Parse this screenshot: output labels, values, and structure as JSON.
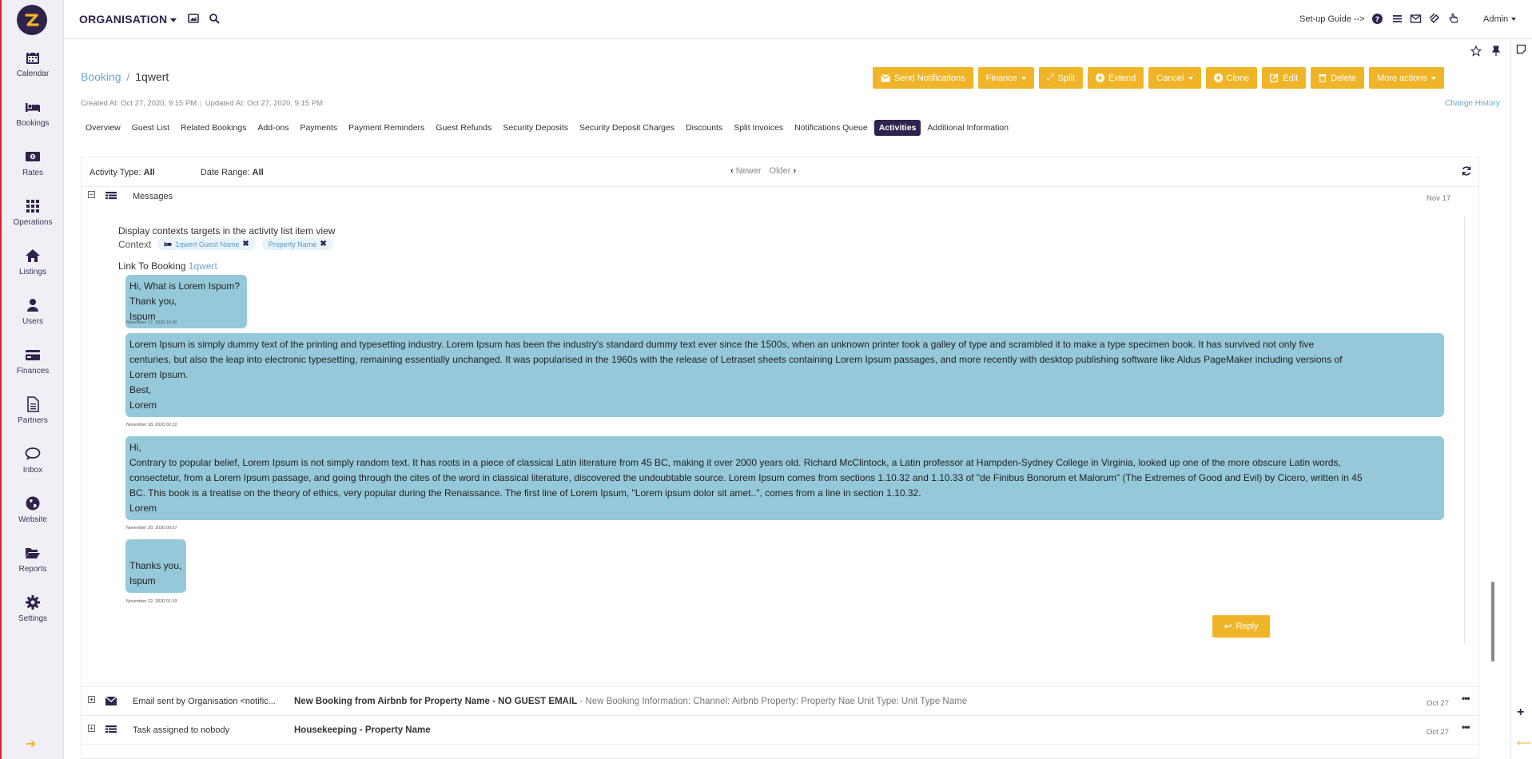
{
  "topbar": {
    "org_label": "ORGANISATION",
    "setup_guide": "Set-up Guide -->",
    "user_label": "Admin"
  },
  "sidebar": {
    "items": [
      {
        "label": "Calendar",
        "icon": "calendar-icon"
      },
      {
        "label": "Bookings",
        "icon": "bed-icon"
      },
      {
        "label": "Rates",
        "icon": "money-icon"
      },
      {
        "label": "Operations",
        "icon": "grid-icon"
      },
      {
        "label": "Listings",
        "icon": "home-icon"
      },
      {
        "label": "Users",
        "icon": "user-icon"
      },
      {
        "label": "Finances",
        "icon": "credit-card-icon"
      },
      {
        "label": "Partners",
        "icon": "file-icon"
      },
      {
        "label": "Inbox",
        "icon": "comments-icon"
      },
      {
        "label": "Website",
        "icon": "globe-icon"
      },
      {
        "label": "Reports",
        "icon": "folder-open-icon"
      },
      {
        "label": "Settings",
        "icon": "gear-icon"
      }
    ]
  },
  "header": {
    "breadcrumb_parent": "Booking",
    "breadcrumb_sep": "/",
    "breadcrumb_current": "1qwert",
    "created": "Created At: Oct 27, 2020, 9:15 PM",
    "updated": "Updated At: Oct 27, 2020, 9:15 PM",
    "change_history": "Change History"
  },
  "actions": {
    "send_notifications": "Send Notifications",
    "finance": "Finance",
    "split": "Split",
    "extend": "Extend",
    "cancel": "Cancel",
    "clone": "Clone",
    "edit": "Edit",
    "delete": "Delete",
    "more_actions": "More actions"
  },
  "tabs": [
    "Overview",
    "Guest List",
    "Related Bookings",
    "Add-ons",
    "Payments",
    "Payment Reminders",
    "Guest Refunds",
    "Security Deposits",
    "Security Deposit Charges",
    "Discounts",
    "Split Invoices",
    "Notifications Queue",
    "Activities",
    "Additional Information"
  ],
  "active_tab": "Activities",
  "filters": {
    "activity_type_label": "Activity Type:",
    "activity_type_value": "All",
    "date_range_label": "Date Range:",
    "date_range_value": "All",
    "newer": "Newer",
    "older": "Older"
  },
  "messages_row": {
    "toggle": "−",
    "title": "Messages",
    "date": "Nov 17",
    "context_heading": "Display contexts targets in the activity list item view",
    "context_label": "Context",
    "chips": [
      "1qwert Guest Name",
      "Property Name"
    ],
    "link_label": "Link To Booking",
    "link_value": "1qwert",
    "bubbles": [
      {
        "lines": [
          "Hi, What is Lorem Ispum?",
          "Thank you,",
          "Ispum"
        ],
        "timestamp": "November 17, 2020 15:40"
      },
      {
        "lines": [
          "Lorem Ipsum is simply dummy text of the printing and typesetting industry. Lorem Ipsum has been the industry's standard dummy text ever since the 1500s, when an unknown printer took a galley of type and scrambled it to make a type specimen book. It has survived not only five",
          "centuries, but also the leap into electronic typesetting, remaining essentially unchanged. It was popularised in the 1960s with the release of Letraset sheets containing Lorem Ipsum passages, and more recently with desktop publishing software like Aldus PageMaker including versions of",
          "Lorem Ipsum.",
          "Best,",
          "Lorem"
        ],
        "timestamp": "November 18, 2020 02:22"
      },
      {
        "lines": [
          "Hi,",
          "Contrary to popular belief, Lorem Ipsum is not simply random text. It has roots in a piece of classical Latin literature from 45 BC, making it over 2000 years old. Richard McClintock, a Latin professor at Hampden-Sydney College in Virginia, looked up one of the more obscure Latin words,",
          "consectetur, from a Lorem Ipsum passage, and going through the cites of the word in classical literature, discovered the undoubtable source. Lorem Ipsum comes from sections 1.10.32 and 1.10.33 of \"de Finibus Bonorum et Malorum\" (The Extremes of Good and Evil) by Cicero, written in 45",
          "BC. This book is a treatise on the theory of ethics, very popular during the Renaissance. The first line of Lorem Ipsum, \"Lorem ipsum dolor sit amet..\", comes from a line in section 1.10.32.",
          "Lorem"
        ],
        "timestamp": "November 20, 2020 00:57"
      },
      {
        "lines": [
          "",
          "Thanks you,",
          "Ispum"
        ],
        "timestamp": "November 22, 2020 01:33"
      }
    ],
    "reply": "Reply"
  },
  "activity_rows": [
    {
      "toggle": "+",
      "title": "Email sent by Organisation <notific...",
      "subject": "New Booking from Airbnb for Property Name - NO GUEST EMAIL",
      "description": " - New Booking Information: Channel: Airbnb Property: Property Nae Unit Type: Unit Type Name",
      "date": "Oct 27"
    },
    {
      "toggle": "+",
      "title": "Task assigned to nobody",
      "subject": "Housekeeping - Property Name",
      "description": "",
      "date": "Oct 27"
    }
  ],
  "colors": {
    "accent": "#f0b429",
    "brand": "#2f234d",
    "bubble": "#95c9d9",
    "link": "#6aa8cf"
  }
}
